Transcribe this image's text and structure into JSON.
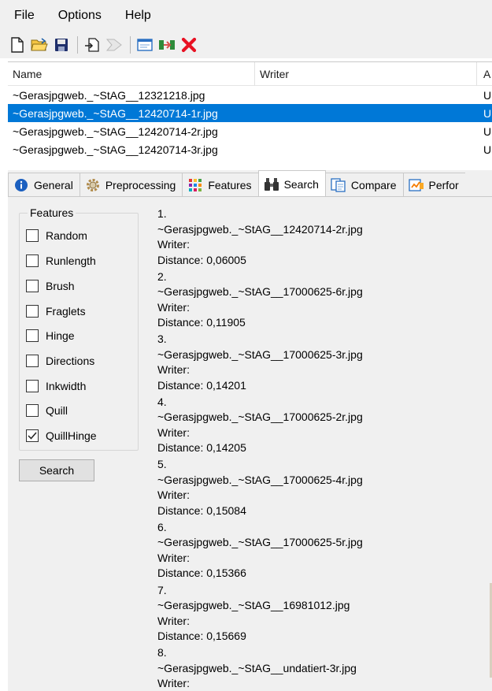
{
  "menu": {
    "items": [
      "File",
      "Options",
      "Help"
    ]
  },
  "toolbar": {
    "buttons": [
      "new-document-icon",
      "open-folder-icon",
      "save-icon",
      "import-icon",
      "arrow-forward-icon",
      "window-icon",
      "merge-icon",
      "delete-icon"
    ]
  },
  "filelist": {
    "columns": [
      "Name",
      "Writer",
      "A"
    ],
    "rows": [
      {
        "name": "~Gerasjpgweb._~StAG__12321218.jpg",
        "writer": "",
        "a": "U",
        "selected": false
      },
      {
        "name": "~Gerasjpgweb._~StAG__12420714-1r.jpg",
        "writer": "",
        "a": "U",
        "selected": true
      },
      {
        "name": "~Gerasjpgweb._~StAG__12420714-2r.jpg",
        "writer": "",
        "a": "U",
        "selected": false
      },
      {
        "name": "~Gerasjpgweb._~StAG__12420714-3r.jpg",
        "writer": "",
        "a": "U",
        "selected": false
      }
    ]
  },
  "tabs": [
    {
      "label": "General",
      "icon": "info-icon",
      "active": false
    },
    {
      "label": "Preprocessing",
      "icon": "gear-icon",
      "active": false
    },
    {
      "label": "Features",
      "icon": "grid-icon",
      "active": false
    },
    {
      "label": "Search",
      "icon": "binoculars-icon",
      "active": true
    },
    {
      "label": "Compare",
      "icon": "compare-icon",
      "active": false
    },
    {
      "label": "Perfor",
      "icon": "performance-icon",
      "active": false
    }
  ],
  "features": {
    "legend": "Features",
    "items": [
      {
        "label": "Random",
        "checked": false
      },
      {
        "label": "Runlength",
        "checked": false
      },
      {
        "label": "Brush",
        "checked": false
      },
      {
        "label": "Fraglets",
        "checked": false
      },
      {
        "label": "Hinge",
        "checked": false
      },
      {
        "label": "Directions",
        "checked": false
      },
      {
        "label": "Inkwidth",
        "checked": false
      },
      {
        "label": "Quill",
        "checked": false
      },
      {
        "label": "QuillHinge",
        "checked": true
      }
    ],
    "search_label": "Search"
  },
  "results": [
    {
      "rank": "1.",
      "file": "~Gerasjpgweb._~StAG__12420714-2r.jpg",
      "writer": "Writer:",
      "distance": "Distance: 0,06005"
    },
    {
      "rank": "2.",
      "file": "~Gerasjpgweb._~StAG__17000625-6r.jpg",
      "writer": "Writer:",
      "distance": "Distance: 0,11905"
    },
    {
      "rank": "3.",
      "file": "~Gerasjpgweb._~StAG__17000625-3r.jpg",
      "writer": "Writer:",
      "distance": "Distance: 0,14201"
    },
    {
      "rank": "4.",
      "file": "~Gerasjpgweb._~StAG__17000625-2r.jpg",
      "writer": "Writer:",
      "distance": "Distance: 0,14205"
    },
    {
      "rank": "5.",
      "file": "~Gerasjpgweb._~StAG__17000625-4r.jpg",
      "writer": "Writer:",
      "distance": "Distance: 0,15084"
    },
    {
      "rank": "6.",
      "file": "~Gerasjpgweb._~StAG__17000625-5r.jpg",
      "writer": "Writer:",
      "distance": "Distance: 0,15366"
    },
    {
      "rank": "7.",
      "file": "~Gerasjpgweb._~StAG__16981012.jpg",
      "writer": "Writer:",
      "distance": "Distance: 0,15669"
    },
    {
      "rank": "8.",
      "file": "~Gerasjpgweb._~StAG__undatiert-3r.jpg",
      "writer": "Writer:",
      "distance": ""
    }
  ],
  "colors": {
    "selection": "#0078d7",
    "delete": "#e81123"
  }
}
